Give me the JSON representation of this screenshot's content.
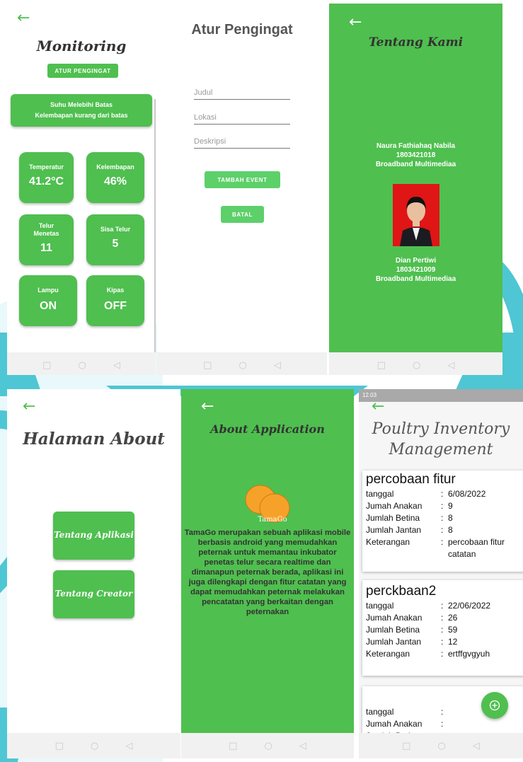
{
  "monitoring": {
    "title": "Monitoring",
    "atur_button": "ATUR PENGINGAT",
    "alert_line1": "Suhu Melebihi Batas",
    "alert_line2": "Kelembapan kurang dari batas",
    "cards": [
      {
        "label": "Temperatur",
        "value": "41.2°C"
      },
      {
        "label": "Kelembapan",
        "value": "46%"
      },
      {
        "label": "Telur\nMenetas",
        "value": "11"
      },
      {
        "label": "Sisa Telur",
        "value": "5"
      },
      {
        "label": "Lampu",
        "value": "ON"
      },
      {
        "label": "Kipas",
        "value": "OFF"
      }
    ]
  },
  "atur": {
    "title": "Atur Pengingat",
    "judul_placeholder": "Judul",
    "lokasi_placeholder": "Lokasi",
    "deskripsi_placeholder": "Deskripsi",
    "tambah_button": "TAMBAH EVENT",
    "batal_button": "BATAL"
  },
  "tentang_kami": {
    "title": "Tentang Kami",
    "member1": {
      "name": "Naura Fathiahaq Nabila",
      "nim": "1803421018",
      "prodi": "Broadband Multimediaa"
    },
    "member2": {
      "name": "Dian Pertiwi",
      "nim": "1803421009",
      "prodi": "Broadband Multimediaa"
    }
  },
  "halaman_about": {
    "title": "Halaman About",
    "btn_aplikasi": "Tentang Aplikasi",
    "btn_creator": "Tentang Creator"
  },
  "about_app": {
    "title": "About Application",
    "logo_text": "TamaGo",
    "description": "TamaGo merupakan sebuah aplikasi mobile berbasis android yang memudahkan peternak untuk memantau inkubator penetas telur secara realtime dan dimanapun peternak berada,  aplikasi ini juga dilengkapi dengan fitur catatan yang dapat memudahkan peternak melakukan pencatatan yang berkaitan dengan peternakan"
  },
  "inventory": {
    "status_time": "12.03",
    "title_line1": "Poultry Inventory",
    "title_line2": "Management",
    "labels": {
      "tanggal": "tanggal",
      "anakan": "Jumah Anakan",
      "betina": "Jumlah Betina",
      "jantan": "Jumlah Jantan",
      "ket": "Keterangan"
    },
    "records": [
      {
        "title": "percobaan fitur",
        "tanggal": "6/08/2022",
        "anakan": "9",
        "betina": "8",
        "jantan": "8",
        "ket": "percobaan fitur catatan"
      },
      {
        "title": "perckbaan2",
        "tanggal": "22/06/2022",
        "anakan": "26",
        "betina": "59",
        "jantan": "12",
        "ket": "ertffgvgyuh"
      }
    ],
    "fab_icon": "plus-circle-icon"
  },
  "nav": {
    "square": "□",
    "circle": "○",
    "back": "◁"
  },
  "colors": {
    "green": "#4fbf4f",
    "accent_cyan": "#4fc6d3"
  }
}
